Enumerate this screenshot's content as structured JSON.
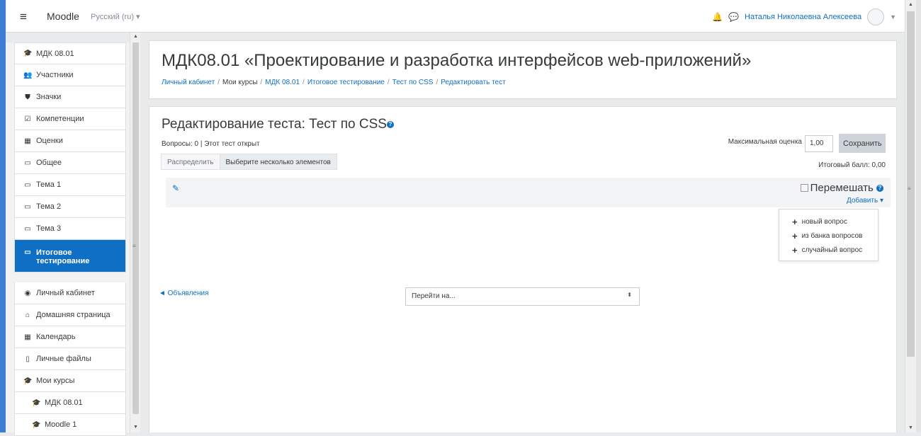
{
  "navbar": {
    "brand": "Moodle",
    "language": "Русский (ru)",
    "user_name": "Наталья Николаевна Алексеева"
  },
  "sidebar": {
    "items": [
      {
        "icon": "graduation-cap-icon",
        "glyph": "🎓",
        "label": "МДК 08.01"
      },
      {
        "icon": "users-icon",
        "glyph": "👥",
        "label": "Участники"
      },
      {
        "icon": "shield-icon",
        "glyph": "⛊",
        "label": "Значки"
      },
      {
        "icon": "checkbox-icon",
        "glyph": "☑",
        "label": "Компетенции"
      },
      {
        "icon": "table-icon",
        "glyph": "▦",
        "label": "Оценки"
      },
      {
        "icon": "folder-icon",
        "glyph": "▭",
        "label": "Общее"
      },
      {
        "icon": "folder-icon",
        "glyph": "▭",
        "label": "Тема 1"
      },
      {
        "icon": "folder-icon",
        "glyph": "▭",
        "label": "Тема 2"
      },
      {
        "icon": "folder-icon",
        "glyph": "▭",
        "label": "Тема 3"
      },
      {
        "icon": "folder-icon",
        "glyph": "▭",
        "label": "Итоговое тестирование"
      }
    ],
    "nav_items": [
      {
        "icon": "dashboard-icon",
        "glyph": "◉",
        "label": "Личный кабинет"
      },
      {
        "icon": "home-icon",
        "glyph": "⌂",
        "label": "Домашняя страница"
      },
      {
        "icon": "calendar-icon",
        "glyph": "▦",
        "label": "Календарь"
      },
      {
        "icon": "file-icon",
        "glyph": "▯",
        "label": "Личные файлы"
      },
      {
        "icon": "graduation-cap-icon",
        "glyph": "🎓",
        "label": "Мои курсы"
      },
      {
        "icon": "graduation-cap-icon",
        "glyph": "🎓",
        "label": "МДК 08.01"
      },
      {
        "icon": "graduation-cap-icon",
        "glyph": "🎓",
        "label": "Moodle 1"
      }
    ]
  },
  "header": {
    "title": "МДК08.01 «Проектирование и разработка интерфейсов web-приложений»",
    "breadcrumb": [
      "Личный кабинет",
      "Мои курсы",
      "МДК 08.01",
      "Итоговое тестирование",
      "Тест по CSS",
      "Редактировать тест"
    ]
  },
  "main": {
    "heading": "Редактирование теста: Тест по CSS",
    "info": "Вопросы: 0 | Этот тест открыт",
    "tabs": [
      "Распределить",
      "Выберите несколько элементов"
    ],
    "max_grade_label": "Максимальная оценка",
    "max_grade_value": "1,00",
    "save_label": "Сохранить",
    "total_label": "Итоговый балл: 0,00",
    "shuffle_label": "Перемешать",
    "add_label": "Добавить",
    "add_menu": [
      "новый вопрос",
      "из банка вопросов",
      "случайный вопрос"
    ],
    "prev_link": "◄ Объявления",
    "jump_placeholder": "Перейти на..."
  },
  "colors": {
    "accent": "#0f6fc5",
    "sidebar_active": "#0f6fc5"
  }
}
